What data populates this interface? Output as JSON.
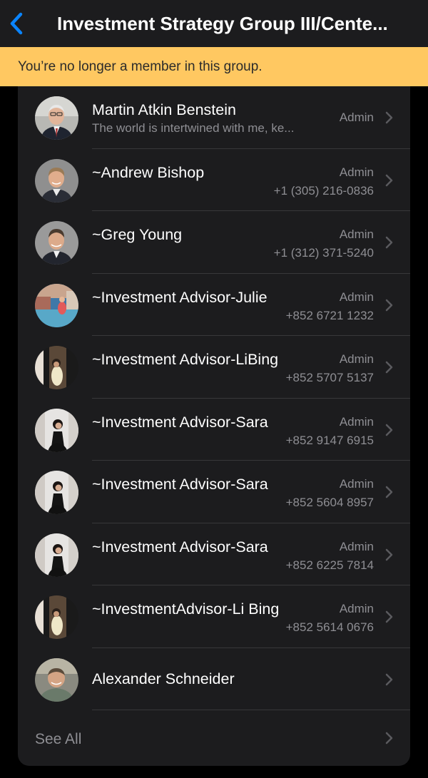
{
  "header": {
    "title": "Investment Strategy Group III/Cente...",
    "back_icon": "chevron-left-icon",
    "accent_color": "#0a84ff"
  },
  "banner": {
    "text": "You’re no longer a member in this group.",
    "background": "#ffc861"
  },
  "members": [
    {
      "name": "Martin Atkin Benstein",
      "role": "Admin",
      "subtitle": "The world is intertwined with me, ke...",
      "phone": ""
    },
    {
      "name": "~Andrew Bishop",
      "role": "Admin",
      "subtitle": "",
      "phone": "+1 (305) 216-0836"
    },
    {
      "name": "~Greg Young",
      "role": "Admin",
      "subtitle": "",
      "phone": "+1 (312) 371-5240"
    },
    {
      "name": "~Investment Advisor-Julie",
      "role": "Admin",
      "subtitle": "",
      "phone": "+852 6721 1232"
    },
    {
      "name": "~Investment Advisor-LiBing",
      "role": "Admin",
      "subtitle": "",
      "phone": "+852 5707 5137"
    },
    {
      "name": "~Investment Advisor-Sara",
      "role": "Admin",
      "subtitle": "",
      "phone": "+852 9147 6915"
    },
    {
      "name": "~Investment Advisor-Sara",
      "role": "Admin",
      "subtitle": "",
      "phone": "+852 5604 8957"
    },
    {
      "name": "~Investment Advisor-Sara",
      "role": "Admin",
      "subtitle": "",
      "phone": "+852 6225 7814"
    },
    {
      "name": "~InvestmentAdvisor-Li Bing",
      "role": "Admin",
      "subtitle": "",
      "phone": "+852 5614 0676"
    },
    {
      "name": "Alexander Schneider",
      "role": "",
      "subtitle": "",
      "phone": ""
    }
  ],
  "see_all": {
    "label": "See All"
  }
}
